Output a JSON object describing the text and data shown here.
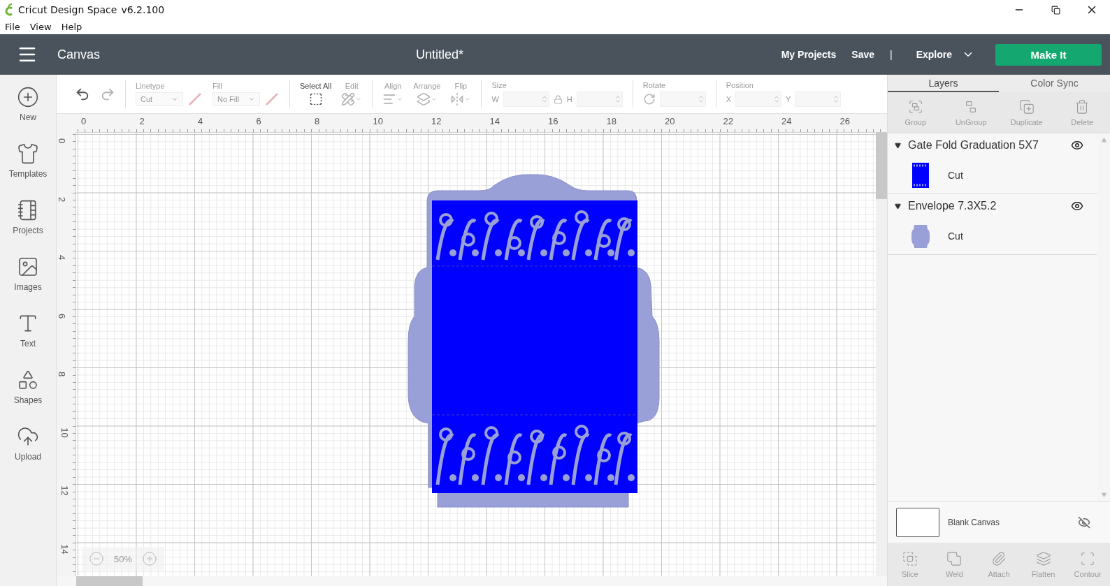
{
  "window": {
    "app_name": "Cricut Design Space",
    "version": "v6.2.100"
  },
  "menu": [
    "File",
    "View",
    "Help"
  ],
  "header": {
    "section": "Canvas",
    "document_title": "Untitled*",
    "links": [
      "My Projects",
      "Save"
    ],
    "separator": "|",
    "explore": "Explore",
    "make_button": "Make It"
  },
  "sidebar": [
    {
      "label": "New"
    },
    {
      "label": "Templates"
    },
    {
      "label": "Projects"
    },
    {
      "label": "Images"
    },
    {
      "label": "Text"
    },
    {
      "label": "Shapes"
    },
    {
      "label": "Upload"
    }
  ],
  "toolbar": [
    [
      {
        "kind": "undo",
        "disabled": false
      },
      {
        "kind": "redo",
        "disabled": true
      }
    ],
    [
      {
        "kind": "select",
        "label": "Linetype",
        "value": "Cut",
        "disabled": true
      },
      {
        "kind": "select",
        "label": "Fill",
        "value": "No Fill",
        "disabled": true
      }
    ],
    [
      {
        "kind": "select_all",
        "label": "Select All",
        "disabled": false
      },
      {
        "kind": "edit",
        "label": "Edit",
        "disabled": true
      }
    ],
    [
      {
        "kind": "align",
        "label": "Align",
        "disabled": true
      },
      {
        "kind": "arrange",
        "label": "Arrange",
        "disabled": true
      },
      {
        "kind": "flip",
        "label": "Flip",
        "disabled": true
      }
    ],
    [
      {
        "kind": "size",
        "label": "Size",
        "fields": [
          "W",
          "H"
        ],
        "disabled": true
      }
    ],
    [
      {
        "kind": "rotate",
        "label": "Rotate",
        "disabled": true
      }
    ],
    [
      {
        "kind": "position",
        "label": "Position",
        "fields": [
          "X",
          "Y"
        ],
        "disabled": true
      }
    ]
  ],
  "ruler": {
    "x_labels": [
      "0",
      "2",
      "4",
      "6",
      "8",
      "10",
      "12",
      "14",
      "16",
      "18",
      "20",
      "22",
      "24",
      "26"
    ],
    "y_labels": [
      "0",
      "2",
      "4",
      "6",
      "8",
      "10",
      "12",
      "14"
    ]
  },
  "zoom": {
    "value": "50%",
    "disabled": true
  },
  "panel": {
    "tabs": [
      {
        "label": "Layers",
        "selected": true
      },
      {
        "label": "Color Sync",
        "selected": false
      }
    ],
    "actions": [
      {
        "label": "Group",
        "disabled": true
      },
      {
        "label": "UnGroup",
        "disabled": true
      },
      {
        "label": "Duplicate",
        "disabled": true
      },
      {
        "label": "Delete",
        "disabled": true
      }
    ],
    "layers": [
      {
        "name": "Gate Fold Graduation 5X7",
        "expanded": true,
        "visible": true,
        "children": [
          {
            "label": "Cut",
            "kind": "card"
          }
        ]
      },
      {
        "name": "Envelope 7.3X5.2",
        "expanded": true,
        "visible": true,
        "children": [
          {
            "label": "Cut",
            "kind": "envelope"
          }
        ]
      }
    ],
    "blank_canvas": {
      "label": "Blank Canvas",
      "visible": false
    },
    "bottom_actions": [
      {
        "label": "Slice",
        "disabled": true
      },
      {
        "label": "Weld",
        "disabled": true
      },
      {
        "label": "Attach",
        "disabled": true
      },
      {
        "label": "Flatten",
        "disabled": true
      },
      {
        "label": "Contour",
        "disabled": true
      }
    ]
  }
}
